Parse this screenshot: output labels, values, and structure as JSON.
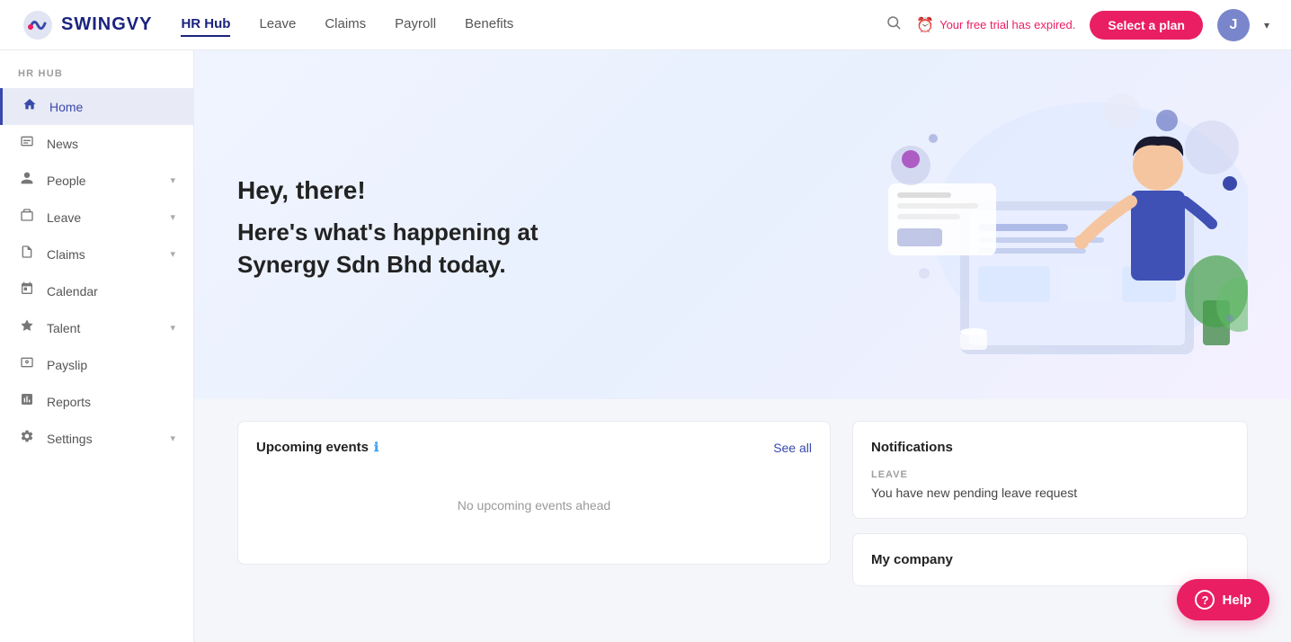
{
  "topnav": {
    "logo_text": "SWINGVY",
    "links": [
      {
        "label": "HR Hub",
        "active": true
      },
      {
        "label": "Leave",
        "active": false
      },
      {
        "label": "Claims",
        "active": false
      },
      {
        "label": "Payroll",
        "active": false
      },
      {
        "label": "Benefits",
        "active": false
      }
    ],
    "trial_text": "Your free trial has expired.",
    "select_plan_label": "Select a plan",
    "avatar_initial": "J"
  },
  "sidebar": {
    "section_label": "HR HUB",
    "items": [
      {
        "label": "Home",
        "active": true,
        "icon": "⌂",
        "has_chevron": false
      },
      {
        "label": "News",
        "active": false,
        "icon": "📰",
        "has_chevron": false
      },
      {
        "label": "People",
        "active": false,
        "icon": "👤",
        "has_chevron": true
      },
      {
        "label": "Leave",
        "active": false,
        "icon": "🗂",
        "has_chevron": true
      },
      {
        "label": "Claims",
        "active": false,
        "icon": "🧾",
        "has_chevron": true
      },
      {
        "label": "Calendar",
        "active": false,
        "icon": "📅",
        "has_chevron": false
      },
      {
        "label": "Talent",
        "active": false,
        "icon": "⭐",
        "has_chevron": true
      },
      {
        "label": "Payslip",
        "active": false,
        "icon": "💳",
        "has_chevron": false
      },
      {
        "label": "Reports",
        "active": false,
        "icon": "📊",
        "has_chevron": false
      },
      {
        "label": "Settings",
        "active": false,
        "icon": "⚙",
        "has_chevron": true
      }
    ]
  },
  "hero": {
    "greeting": "Hey, there!",
    "subtext": "Here's what's happening at Synergy Sdn Bhd today."
  },
  "events": {
    "title": "Upcoming events",
    "see_all": "See all",
    "empty_text": "No upcoming events ahead"
  },
  "notifications": {
    "title": "Notifications",
    "section_label": "LEAVE",
    "message": "You have new pending leave request"
  },
  "company": {
    "title": "My company"
  },
  "help": {
    "label": "Help"
  }
}
